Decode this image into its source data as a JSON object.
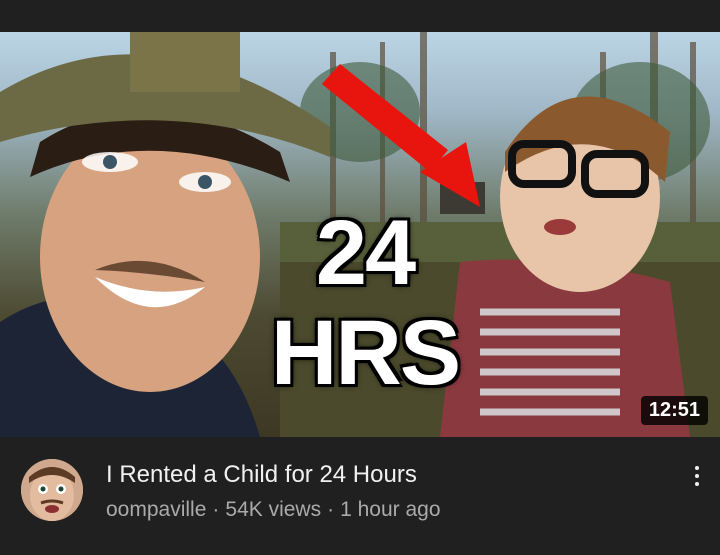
{
  "video": {
    "thumbnail": {
      "overlay_line1": "24",
      "overlay_line2": "HRS",
      "arrow_color": "#e8150f",
      "duration": "12:51"
    },
    "title": "I Rented a Child for 24 Hours",
    "channel": "oompaville",
    "views": "54K views",
    "age": "1 hour ago",
    "separator": "·",
    "menu_icon": "more-vert-icon"
  }
}
